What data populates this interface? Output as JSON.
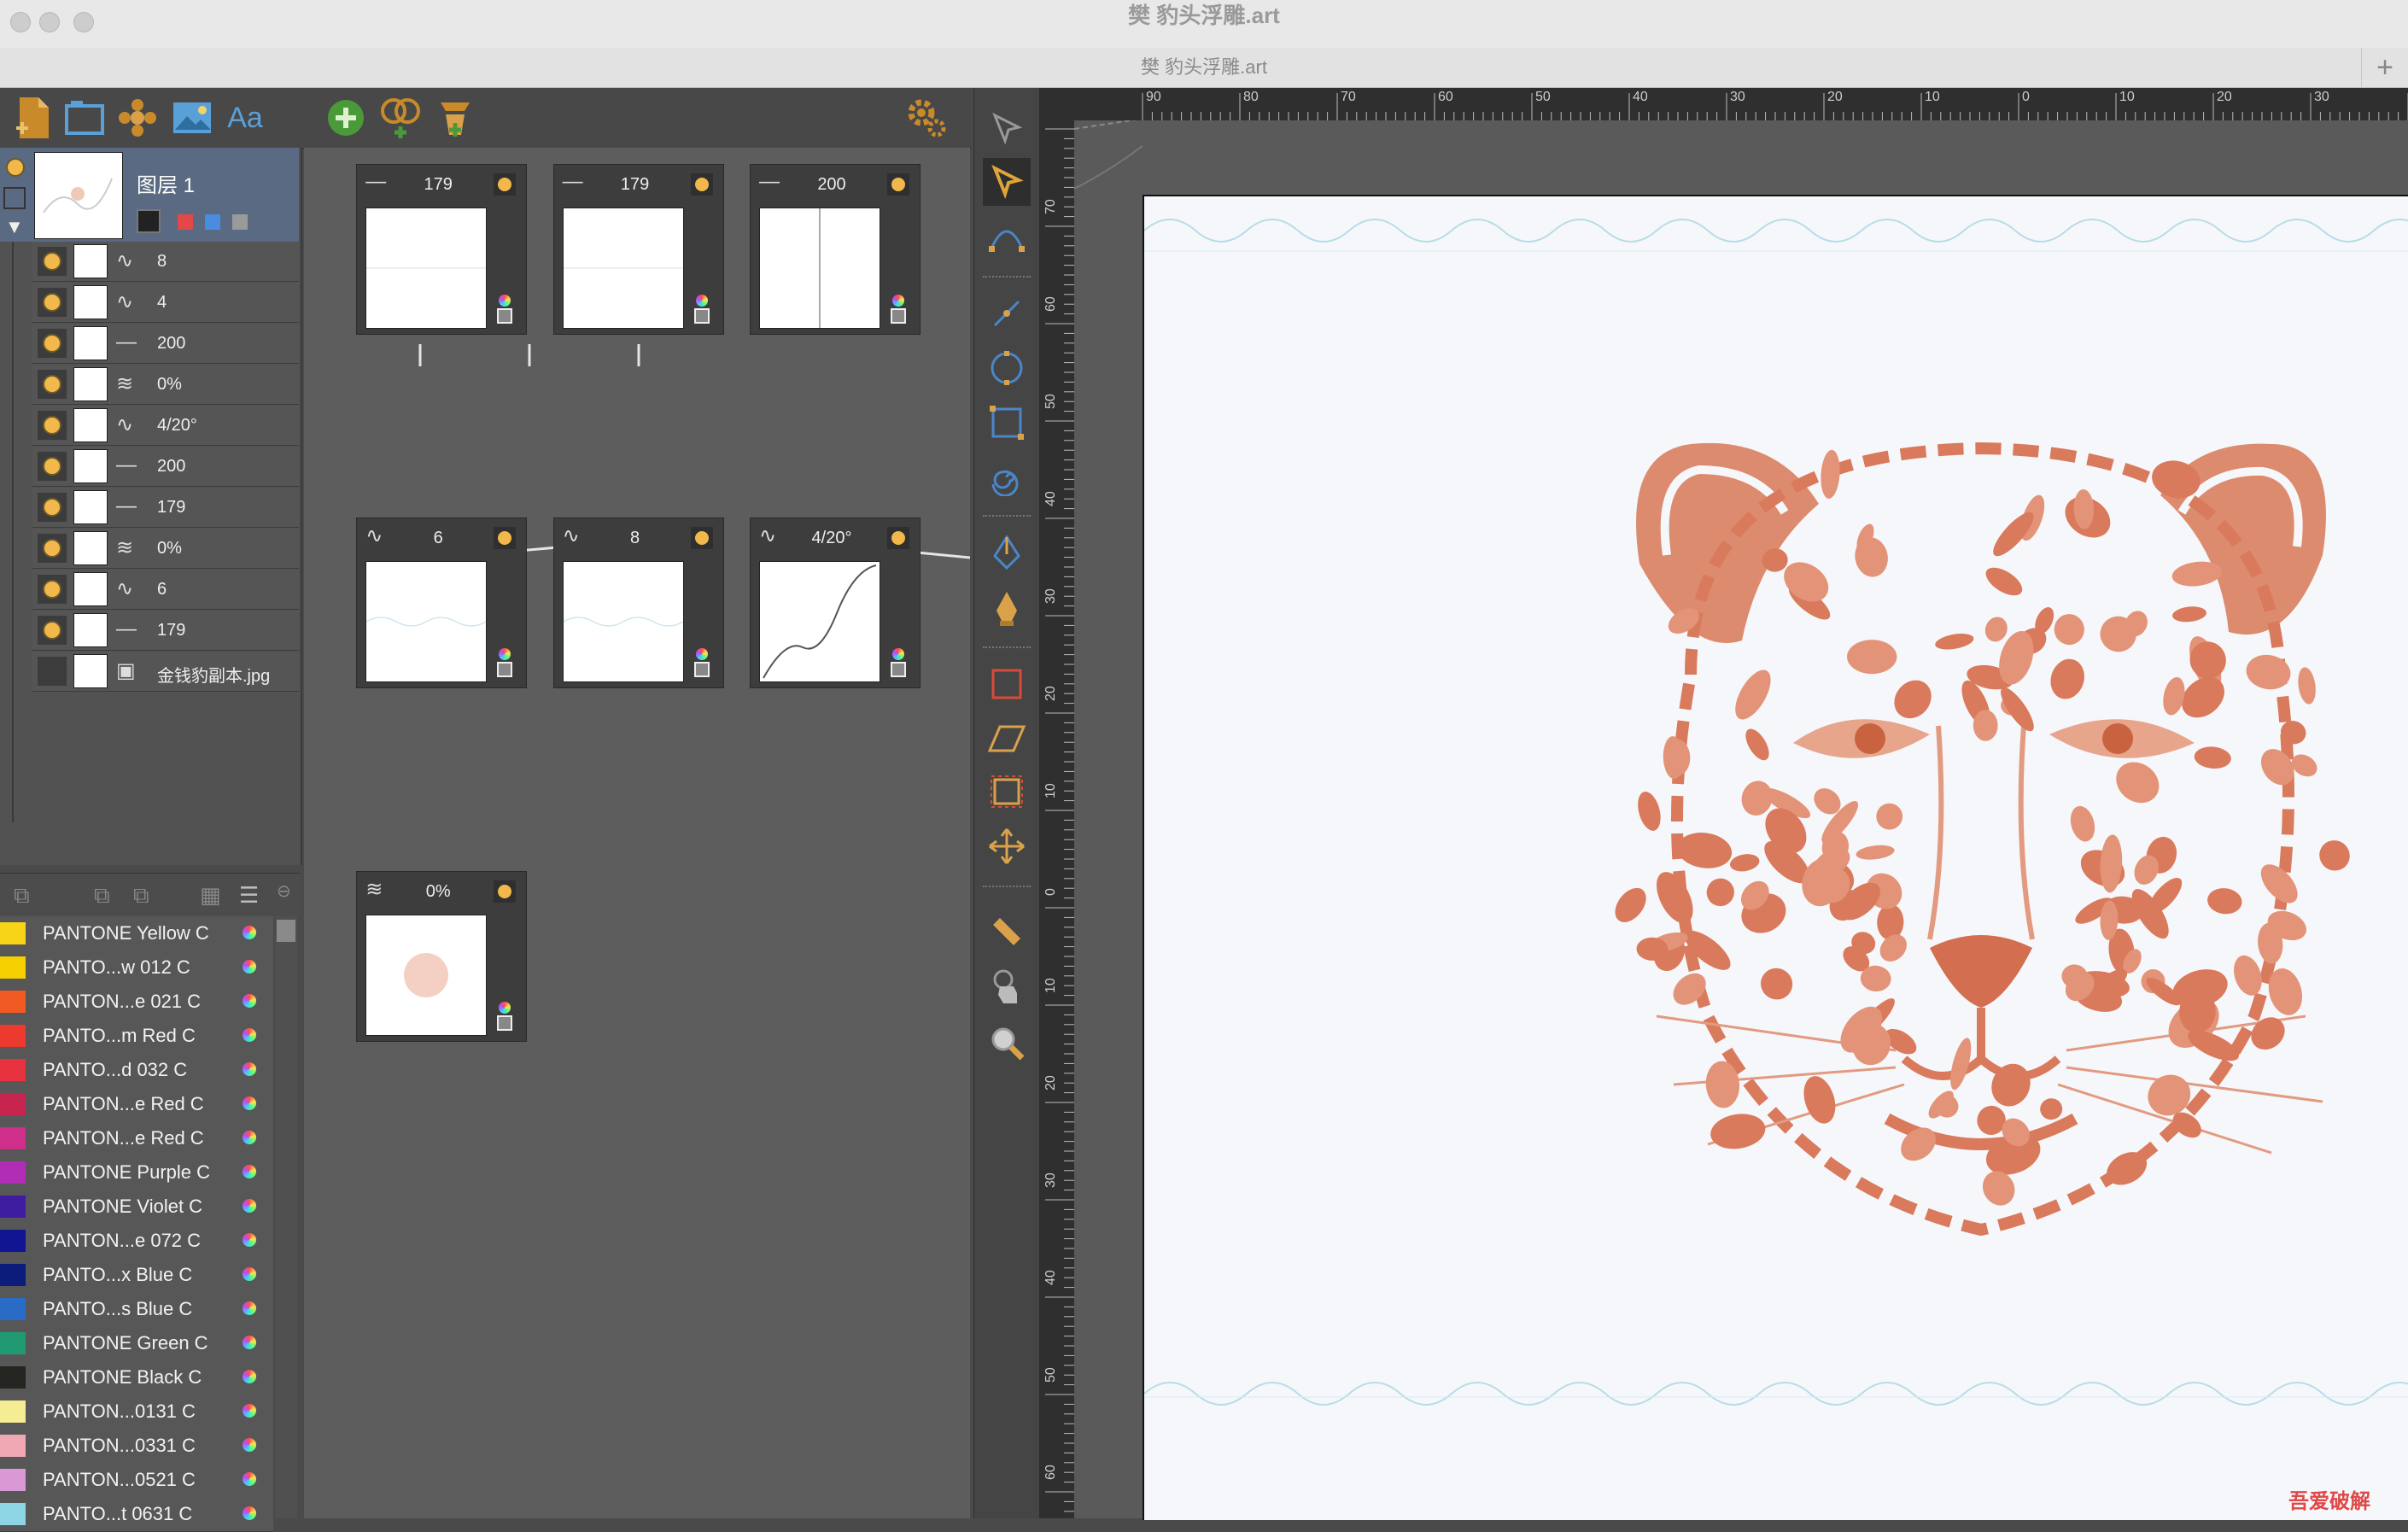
{
  "window": {
    "title": "樊 豹头浮雕.art",
    "tab_label": "樊 豹头浮雕.art",
    "tab_add": "+"
  },
  "layers": {
    "head": {
      "name": "图层 1"
    },
    "rows": [
      {
        "label": "8",
        "type": "wave"
      },
      {
        "label": "4",
        "type": "wave"
      },
      {
        "label": "200",
        "type": "line"
      },
      {
        "label": "0%",
        "type": "multiwave"
      },
      {
        "label": "4/20°",
        "type": "wave"
      },
      {
        "label": "200",
        "type": "line"
      },
      {
        "label": "179",
        "type": "line"
      },
      {
        "label": "0%",
        "type": "multiwave"
      },
      {
        "label": "6",
        "type": "wave"
      },
      {
        "label": "179",
        "type": "line"
      },
      {
        "label": "金钱豹副本.jpg",
        "type": "image"
      }
    ]
  },
  "nodes": [
    {
      "label": "179",
      "type": "line"
    },
    {
      "label": "179",
      "type": "line"
    },
    {
      "label": "200",
      "type": "line"
    },
    {
      "label": "6",
      "type": "wave"
    },
    {
      "label": "8",
      "type": "wave"
    },
    {
      "label": "4/20°",
      "type": "wave"
    },
    {
      "label": "0%",
      "type": "multiwave"
    }
  ],
  "swatches": [
    {
      "name": "PANTONE Yellow C",
      "color": "#f7d417"
    },
    {
      "name": "PANTO...w 012 C",
      "color": "#f6cf00"
    },
    {
      "name": "PANTON...e 021 C",
      "color": "#f15a22"
    },
    {
      "name": "PANTO...m Red C",
      "color": "#ec3b2e"
    },
    {
      "name": "PANTO...d 032 C",
      "color": "#e6313f"
    },
    {
      "name": "PANTON...e Red C",
      "color": "#c7254f"
    },
    {
      "name": "PANTON...e Red C",
      "color": "#cf2e8a"
    },
    {
      "name": "PANTONE Purple C",
      "color": "#b12db5"
    },
    {
      "name": "PANTONE Violet C",
      "color": "#3f1da0"
    },
    {
      "name": "PANTON...e 072 C",
      "color": "#121591"
    },
    {
      "name": "PANTO...x Blue C",
      "color": "#0b1c7a"
    },
    {
      "name": "PANTO...s Blue C",
      "color": "#2a6bc6"
    },
    {
      "name": "PANTONE Green C",
      "color": "#1f9a72"
    },
    {
      "name": "PANTONE Black C",
      "color": "#252522"
    },
    {
      "name": "PANTON...0131 C",
      "color": "#f5ec94"
    },
    {
      "name": "PANTON...0331 C",
      "color": "#f0a8b5"
    },
    {
      "name": "PANTON...0521 C",
      "color": "#d999d4"
    },
    {
      "name": "PANTO...t 0631 C",
      "color": "#8ed6e6"
    }
  ],
  "rulers": {
    "top": [
      "90",
      "80",
      "70",
      "60",
      "50",
      "40",
      "30",
      "20",
      "10",
      "0",
      "10",
      "20",
      "30"
    ],
    "left": [
      "70",
      "60",
      "50",
      "40",
      "30",
      "20",
      "10",
      "0",
      "10",
      "20",
      "30",
      "40",
      "50",
      "60"
    ]
  },
  "colors": {
    "artwork": "#d97a5c",
    "guide_wave": "#b6dde6",
    "layer_head": "#5a6a82"
  },
  "watermark": "吾爱破解"
}
